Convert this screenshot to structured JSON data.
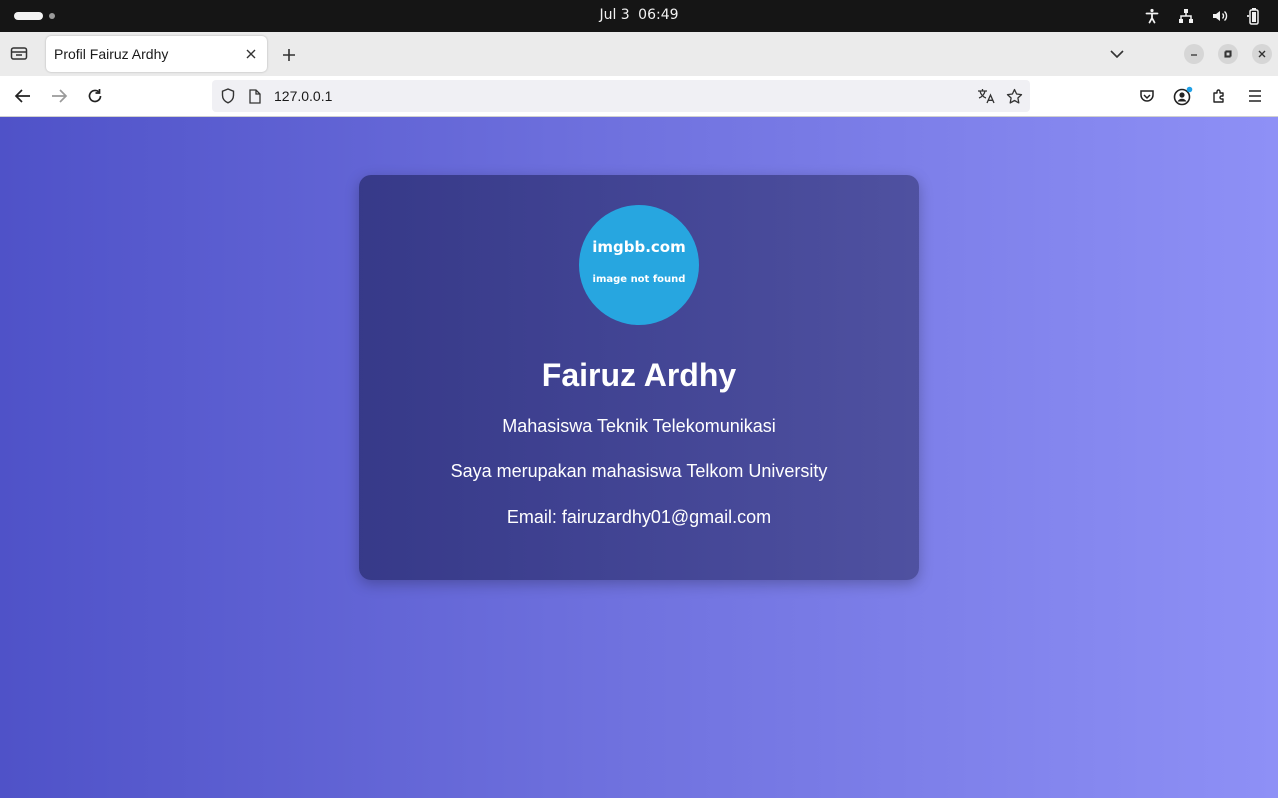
{
  "system": {
    "date": "Jul 3",
    "time": "06:49"
  },
  "browser": {
    "tab_title": "Profil Fairuz Ardhy",
    "url": "127.0.0.1"
  },
  "profile": {
    "avatar_brand": "imgbb.com",
    "avatar_message": "image not found",
    "name": "Fairuz Ardhy",
    "title": "Mahasiswa Teknik Telekomunikasi",
    "bio": "Saya merupakan mahasiswa Telkom University",
    "email": "Email: fairuzardhy01@gmail.com"
  },
  "colors": {
    "avatar_bg": "#27a6e0",
    "gradient_start": "#4f52c8",
    "gradient_end": "#8e90f6"
  }
}
